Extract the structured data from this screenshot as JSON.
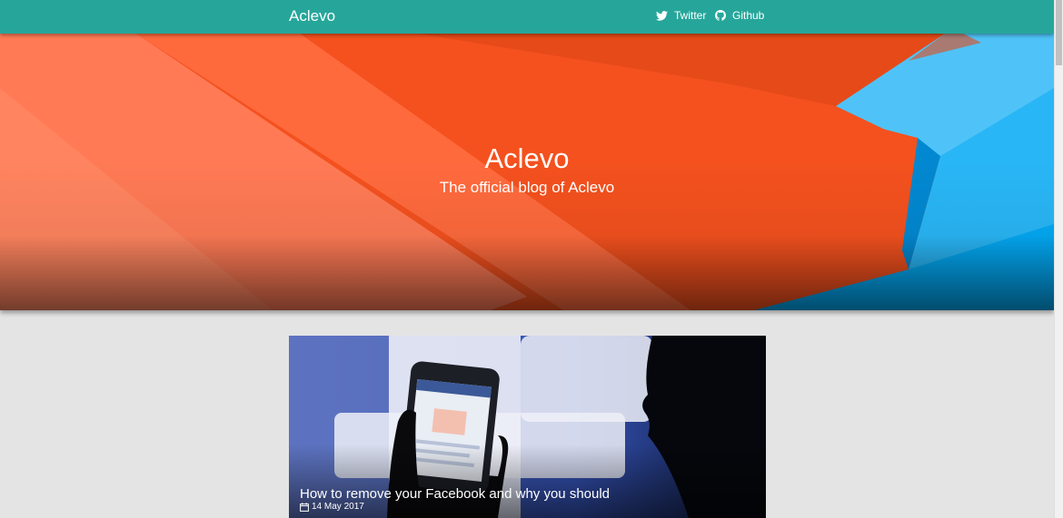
{
  "navbar": {
    "brand": "Aclevo",
    "links": [
      {
        "label": "Twitter",
        "icon": "twitter-icon"
      },
      {
        "label": "Github",
        "icon": "github-icon"
      }
    ],
    "color": "#26a69a"
  },
  "hero": {
    "title": "Aclevo",
    "subtitle": "The official blog of Aclevo",
    "colors": {
      "orange": "#f4511e",
      "blue": "#29b6f6"
    }
  },
  "posts": [
    {
      "title": "How to remove your Facebook and why you should",
      "date": "14 May 2017",
      "date_icon": "calendar-icon"
    }
  ]
}
